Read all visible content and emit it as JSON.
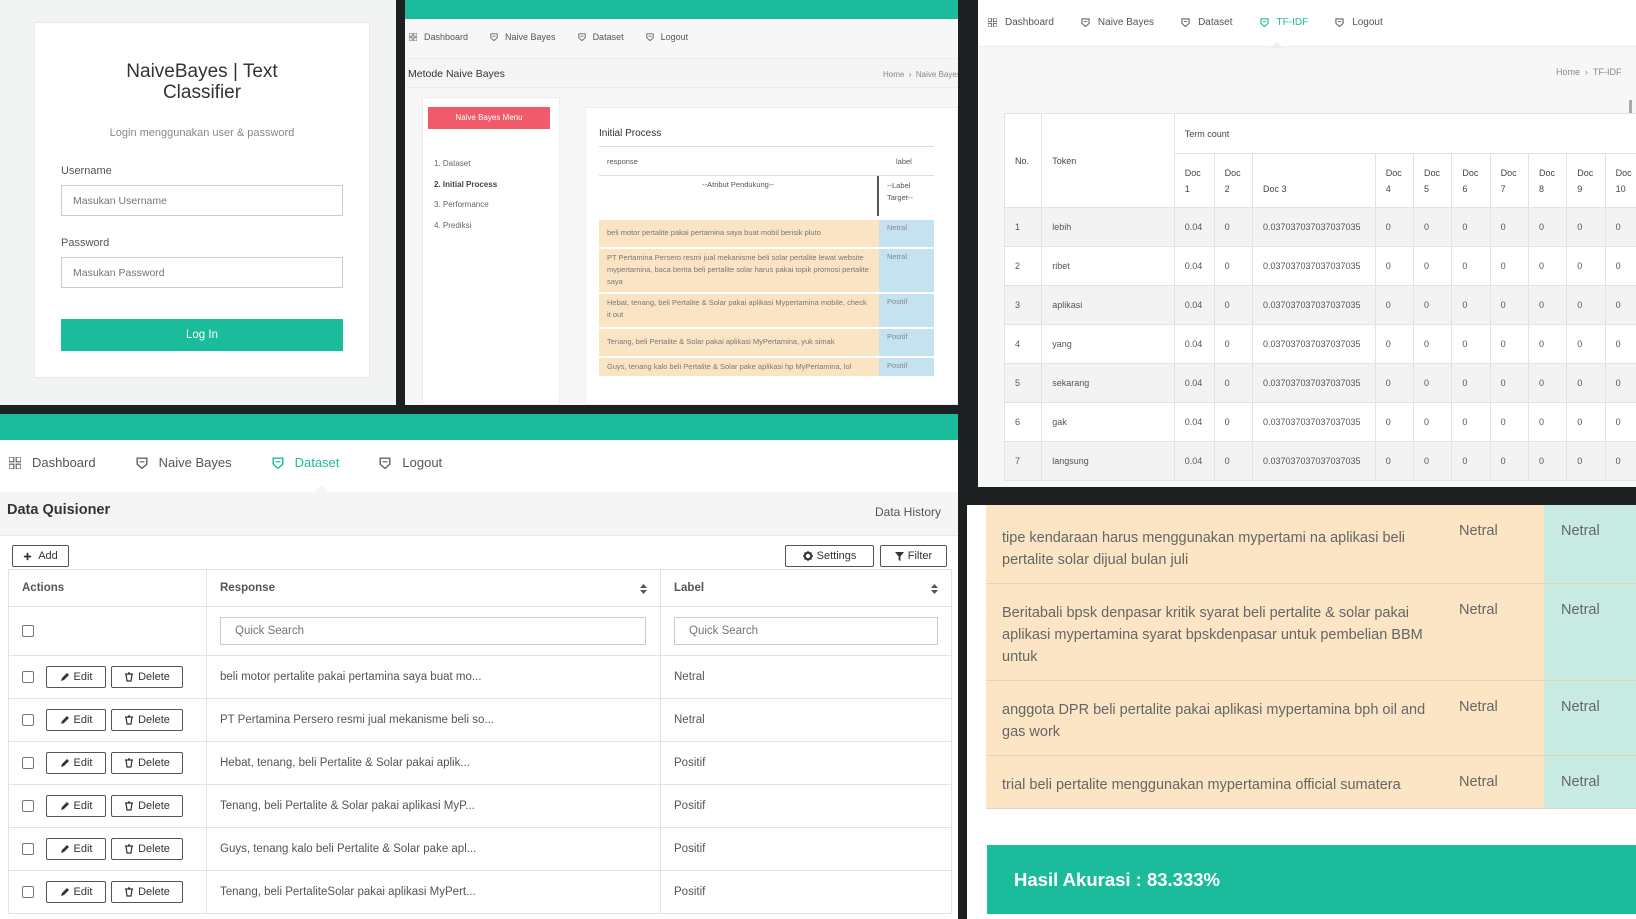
{
  "login": {
    "title": "NaiveBayes | Text Classifier",
    "subtitle": "Login menggunakan user & password",
    "username_label": "Username",
    "username_placeholder": "Masukan Username",
    "password_label": "Password",
    "password_placeholder": "Masukan Password",
    "button": "Log In"
  },
  "naive_bayes": {
    "nav": [
      "Dashboard",
      "Naive Bayes",
      "Dataset",
      "Logout"
    ],
    "page_title": "Metode Naive Bayes",
    "breadcrumb": [
      "Home",
      "Naive Bayes"
    ],
    "menu_button": "Naive Bayes Menu",
    "steps": [
      "1. Dataset",
      "2. Initial Process",
      "3. Performance",
      "4. Prediksi"
    ],
    "panel_title": "Initial Process",
    "col_response": "response",
    "col_label": "label",
    "attr_header": "--Atribut Pendukung--",
    "label_header": "--Label Target--",
    "rows": [
      {
        "response": "beli motor pertalite pakai pertamina saya buat mobil berisik pluto",
        "label": "Netral"
      },
      {
        "response": "PT Pertamina Persero resmi jual mekanisme beli solar pertalite lewat website mypertamina, baca berita beli pertalite solar harus pakai topik promosi pertalite saya",
        "label": "Netral"
      },
      {
        "response": "Hebat, tenang, beli Pertalite & Solar pakai aplikasi Mypertamina mobile, check it out",
        "label": "Positif"
      },
      {
        "response": "Tenang, beli Pertalite & Solar pakai aplikasi MyPertamina, yuk simak",
        "label": "Positif"
      },
      {
        "response": "Guys, tenang kalo beli Pertalite & Solar pake aplikasi hp MyPertamina, lol",
        "label": "Positif"
      }
    ]
  },
  "tfidf": {
    "nav": [
      "Dashboard",
      "Naive Bayes",
      "Dataset",
      "TF-IDF",
      "Logout"
    ],
    "breadcrumb": [
      "Home",
      "TF-IDF"
    ],
    "col_no": "No.",
    "col_token": "Token",
    "term_count": "Term count",
    "docs": [
      {
        "top": "Doc",
        "bottom": "1"
      },
      {
        "top": "Doc",
        "bottom": "2"
      },
      {
        "top": "",
        "bottom": "Doc 3"
      },
      {
        "top": "Doc",
        "bottom": "4"
      },
      {
        "top": "Doc",
        "bottom": "5"
      },
      {
        "top": "Doc",
        "bottom": "6"
      },
      {
        "top": "Doc",
        "bottom": "7"
      },
      {
        "top": "Doc",
        "bottom": "8"
      },
      {
        "top": "Doc",
        "bottom": "9"
      },
      {
        "top": "Doc",
        "bottom": "10"
      }
    ],
    "rows": [
      {
        "no": "1",
        "token": "lebih",
        "vals": [
          "0.04",
          "0",
          "0.037037037037037035",
          "0",
          "0",
          "0",
          "0",
          "0",
          "0",
          "0"
        ]
      },
      {
        "no": "2",
        "token": "ribet",
        "vals": [
          "0.04",
          "0",
          "0.037037037037037035",
          "0",
          "0",
          "0",
          "0",
          "0",
          "0",
          "0"
        ]
      },
      {
        "no": "3",
        "token": "aplikasi",
        "vals": [
          "0.04",
          "0",
          "0.037037037037037035",
          "0",
          "0",
          "0",
          "0",
          "0",
          "0",
          "0"
        ]
      },
      {
        "no": "4",
        "token": "yang",
        "vals": [
          "0.04",
          "0",
          "0.037037037037037035",
          "0",
          "0",
          "0",
          "0",
          "0",
          "0",
          "0"
        ]
      },
      {
        "no": "5",
        "token": "sekarang",
        "vals": [
          "0.04",
          "0",
          "0.037037037037037035",
          "0",
          "0",
          "0",
          "0",
          "0",
          "0",
          "0"
        ]
      },
      {
        "no": "6",
        "token": "gak",
        "vals": [
          "0.04",
          "0",
          "0.037037037037037035",
          "0",
          "0",
          "0",
          "0",
          "0",
          "0",
          "0"
        ]
      },
      {
        "no": "7",
        "token": "langsung",
        "vals": [
          "0.04",
          "0",
          "0.037037037037037035",
          "0",
          "0",
          "0",
          "0",
          "0",
          "0",
          "0"
        ]
      }
    ]
  },
  "dataset": {
    "nav": [
      "Dashboard",
      "Naive Bayes",
      "Dataset",
      "Logout"
    ],
    "page_title": "Data Quisioner",
    "data_history": "Data History",
    "add": "Add",
    "settings": "Settings",
    "filter": "Filter",
    "col_actions": "Actions",
    "col_response": "Response",
    "col_label": "Label",
    "search_placeholder": "Quick Search",
    "edit": "Edit",
    "delete": "Delete",
    "rows": [
      {
        "response": "beli motor pertalite pakai pertamina saya buat mo...",
        "label": "Netral"
      },
      {
        "response": "PT Pertamina Persero resmi jual mekanisme beli so...",
        "label": "Netral"
      },
      {
        "response": "Hebat, tenang, beli Pertalite & Solar pakai aplik...",
        "label": "Positif"
      },
      {
        "response": "Tenang, beli Pertalite & Solar pakai aplikasi MyP...",
        "label": "Positif"
      },
      {
        "response": "Guys, tenang kalo beli Pertalite & Solar pake apl...",
        "label": "Positif"
      },
      {
        "response": "Tenang, beli PertaliteSolar pakai aplikasi MyPert...",
        "label": "Positif"
      }
    ]
  },
  "results": {
    "rows": [
      {
        "text": "tipe kendaraan harus menggunakan mypertami na aplikasi beli pertalite solar dijual bulan juli",
        "actual": "Netral",
        "predicted": "Netral"
      },
      {
        "text": "Beritabali bpsk denpasar kritik syarat beli pertalite & solar pakai aplikasi mypertamina syarat bpskdenpasar untuk pembelian BBM untuk",
        "actual": "Netral",
        "predicted": "Netral"
      },
      {
        "text": "anggota DPR beli pertalite pakai aplikasi mypertamina bph oil and gas work",
        "actual": "Netral",
        "predicted": "Netral"
      },
      {
        "text": "trial beli pertalite menggunakan mypertamina official sumatera",
        "actual": "Netral",
        "predicted": "Netral"
      }
    ],
    "accuracy": "Hasil Akurasi : 83.333%"
  },
  "colors": {
    "accent": "#1bbc9b",
    "menu_button": "#f05a6b",
    "response_bg": "#fbe4c4",
    "label_bg": "#c4e2ef"
  },
  "icons": [
    "dashboard-icon",
    "shield-icon",
    "plus-icon",
    "gear-icon",
    "filter-icon",
    "pencil-icon",
    "trash-icon",
    "sort-icon"
  ]
}
